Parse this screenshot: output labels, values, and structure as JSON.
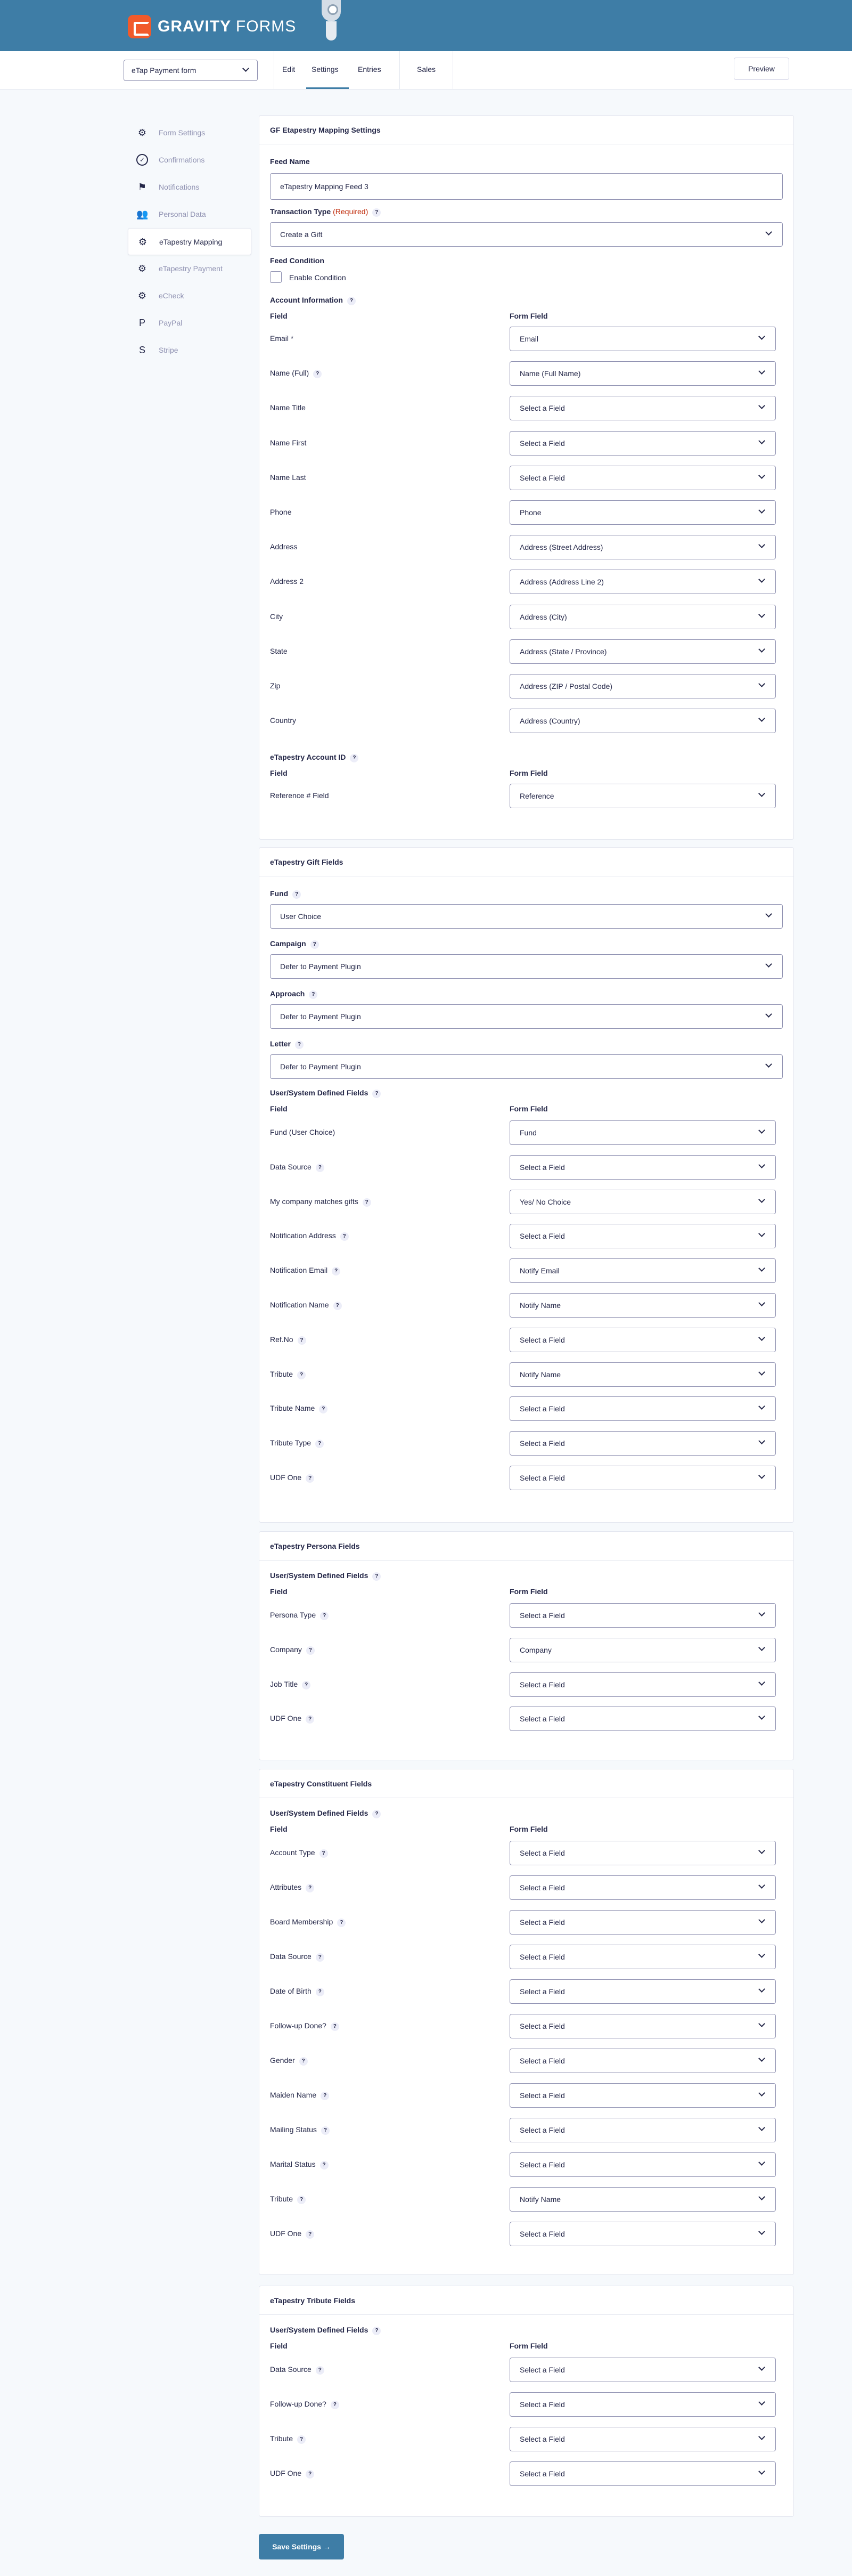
{
  "brand": {
    "name_bold": "GRAVITY",
    "name_rest": "FORMS"
  },
  "toolbar": {
    "form_name": "eTap Payment form",
    "tabs": [
      "Edit",
      "Settings",
      "Entries",
      "Sales"
    ],
    "preview": "Preview"
  },
  "sidebar": [
    "Form Settings",
    "Confirmations",
    "Notifications",
    "Personal Data",
    "eTapestry Mapping",
    "eTapestry Payment",
    "eCheck",
    "PayPal",
    "Stripe"
  ],
  "sidebar_icons": [
    "gear-icon",
    "check-circle-icon",
    "flag-icon",
    "users-icon",
    "gear-icon",
    "gear-icon",
    "gear-icon",
    "paypal-icon",
    "stripe-icon"
  ],
  "p1": {
    "title": "GF Etapestry Mapping Settings",
    "feed_name_label": "Feed Name",
    "feed_name_value": "eTapestry Mapping Feed 3",
    "transaction_label": "Transaction Type",
    "required": "(Required)",
    "transaction_value": "Create a Gift",
    "feed_condition_label": "Feed Condition",
    "enable_condition": "Enable Condition",
    "account_info": "Account Information",
    "col_field": "Field",
    "col_form_field": "Form Field",
    "rows": [
      [
        "Email *",
        "Email",
        0
      ],
      [
        "Name (Full)",
        "Name (Full Name)",
        1
      ],
      [
        "Name Title",
        "Select a Field",
        0
      ],
      [
        "Name First",
        "Select a Field",
        0
      ],
      [
        "Name Last",
        "Select a Field",
        0
      ],
      [
        "Phone",
        "Phone",
        0
      ],
      [
        "Address",
        "Address (Street Address)",
        0
      ],
      [
        "Address 2",
        "Address (Address Line 2)",
        0
      ],
      [
        "City",
        "Address (City)",
        0
      ],
      [
        "State",
        "Address (State / Province)",
        0
      ],
      [
        "Zip",
        "Address (ZIP / Postal Code)",
        0
      ],
      [
        "Country",
        "Address (Country)",
        0
      ]
    ],
    "account_id_label": "eTapestry Account ID",
    "ref_label": "Reference # Field",
    "ref_value": "Reference"
  },
  "p2": {
    "title": "eTapestry Gift Fields",
    "fund_label": "Fund",
    "fund_value": "User Choice",
    "campaign_label": "Campaign",
    "campaign_value": "Defer to Payment Plugin",
    "approach_label": "Approach",
    "approach_value": "Defer to Payment Plugin",
    "letter_label": "Letter",
    "letter_value": "Defer to Payment Plugin",
    "udf_label": "User/System Defined Fields",
    "col_field": "Field",
    "col_form_field": "Form Field",
    "rows": [
      [
        "Fund (User Choice)",
        "Fund",
        0
      ],
      [
        "Data Source",
        "Select a Field",
        1
      ],
      [
        "My company matches gifts",
        "Yes/ No Choice",
        1
      ],
      [
        "Notification Address",
        "Select a Field",
        1
      ],
      [
        "Notification Email",
        "Notify Email",
        1
      ],
      [
        "Notification Name",
        "Notify Name",
        1
      ],
      [
        "Ref.No",
        "Select a Field",
        1
      ],
      [
        "Tribute",
        "Notify Name",
        1
      ],
      [
        "Tribute Name",
        "Select a Field",
        1
      ],
      [
        "Tribute Type",
        "Select a Field",
        1
      ],
      [
        "UDF One",
        "Select a Field",
        1
      ]
    ]
  },
  "p3": {
    "title": "eTapestry Persona Fields",
    "udf_label": "User/System Defined Fields",
    "col_field": "Field",
    "col_form_field": "Form Field",
    "rows": [
      [
        "Persona Type",
        "Select a Field",
        1
      ],
      [
        "Company",
        "Company",
        1
      ],
      [
        "Job Title",
        "Select a Field",
        1
      ],
      [
        "UDF One",
        "Select a Field",
        1
      ]
    ]
  },
  "p4": {
    "title": "eTapestry Constituent Fields",
    "udf_label": "User/System Defined Fields",
    "col_field": "Field",
    "col_form_field": "Form Field",
    "rows": [
      [
        "Account Type",
        "Select a Field",
        1
      ],
      [
        "Attributes",
        "Select a Field",
        1
      ],
      [
        "Board Membership",
        "Select a Field",
        1
      ],
      [
        "Data Source",
        "Select a Field",
        1
      ],
      [
        "Date of Birth",
        "Select a Field",
        1
      ],
      [
        "Follow-up Done?",
        "Select a Field",
        1
      ],
      [
        "Gender",
        "Select a Field",
        1
      ],
      [
        "Maiden Name",
        "Select a Field",
        1
      ],
      [
        "Mailing Status",
        "Select a Field",
        1
      ],
      [
        "Marital Status",
        "Select a Field",
        1
      ],
      [
        "Tribute",
        "Notify Name",
        1
      ],
      [
        "UDF One",
        "Select a Field",
        1
      ]
    ]
  },
  "p5": {
    "title": "eTapestry Tribute Fields",
    "udf_label": "User/System Defined Fields",
    "col_field": "Field",
    "col_form_field": "Form Field",
    "rows": [
      [
        "Data Source",
        "Select a Field",
        1
      ],
      [
        "Follow-up Done?",
        "Select a Field",
        1
      ],
      [
        "Tribute",
        "Select a Field",
        1
      ],
      [
        "UDF One",
        "Select a Field",
        1
      ]
    ]
  },
  "save_label": "Save Settings →"
}
